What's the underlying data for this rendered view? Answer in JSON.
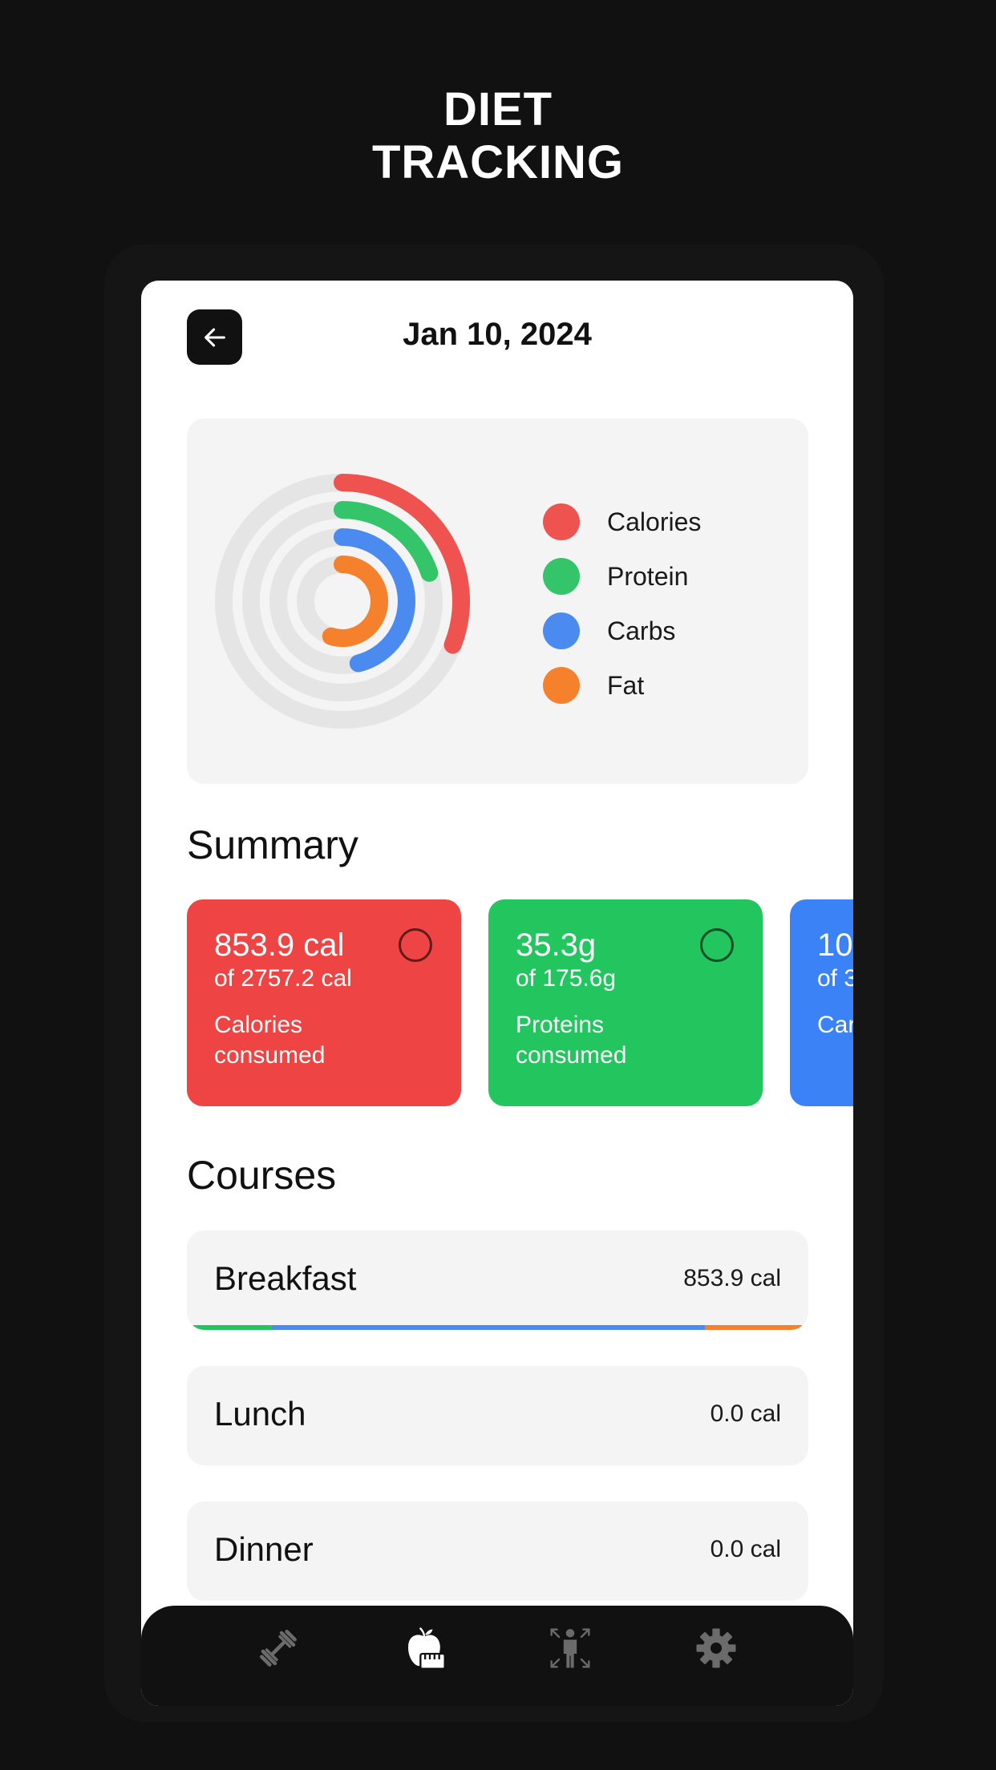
{
  "promo": {
    "line1": "DIET",
    "line2": "TRACKING"
  },
  "header": {
    "back_icon": "arrow-left-icon",
    "date": "Jan 10, 2024"
  },
  "chart_data": {
    "type": "radial-bar",
    "title": "",
    "start_angle": "top (12 o'clock), clockwise",
    "series": [
      {
        "name": "Calories",
        "fraction": 0.31,
        "color": "#ef5350"
      },
      {
        "name": "Protein",
        "fraction": 0.2,
        "color": "#34c46a"
      },
      {
        "name": "Carbs",
        "fraction": 0.46,
        "color": "#4b8bf0"
      },
      {
        "name": "Fat",
        "fraction": 0.55,
        "color": "#f5812d"
      }
    ],
    "track_color": "#e5e5e5",
    "legend": [
      "Calories",
      "Protein",
      "Carbs",
      "Fat"
    ],
    "legend_placement": "right"
  },
  "summary": {
    "title": "Summary",
    "cards": [
      {
        "value": "853.9 cal",
        "of": "of 2757.2 cal",
        "label": "Calories consumed",
        "color": "#ef4444"
      },
      {
        "value": "35.3g",
        "of": "of 175.6g",
        "label": "Proteins consumed",
        "color": "#22c55e"
      },
      {
        "value": "10",
        "of": "of 3",
        "label": "Car",
        "color": "#3b82f6"
      }
    ]
  },
  "courses": {
    "title": "Courses",
    "items": [
      {
        "name": "Breakfast",
        "calories": "853.9 cal",
        "macro_split": [
          {
            "macro": "Protein",
            "fraction": 0.13,
            "color": "#22c55e"
          },
          {
            "macro": "Carbs",
            "fraction": 0.71,
            "color": "#4b8bf0"
          },
          {
            "macro": "Fat",
            "fraction": 0.16,
            "color": "#f5812d"
          }
        ]
      },
      {
        "name": "Lunch",
        "calories": "0.0 cal",
        "macro_split": []
      },
      {
        "name": "Dinner",
        "calories": "0.0 cal",
        "macro_split": []
      }
    ]
  },
  "nav": {
    "items": [
      {
        "icon": "dumbbell-icon",
        "active": false
      },
      {
        "icon": "apple-measure-icon",
        "active": true
      },
      {
        "icon": "body-measure-icon",
        "active": false
      },
      {
        "icon": "gear-icon",
        "active": false
      }
    ],
    "active_color": "#ffffff",
    "inactive_color": "#6b6b6b"
  }
}
